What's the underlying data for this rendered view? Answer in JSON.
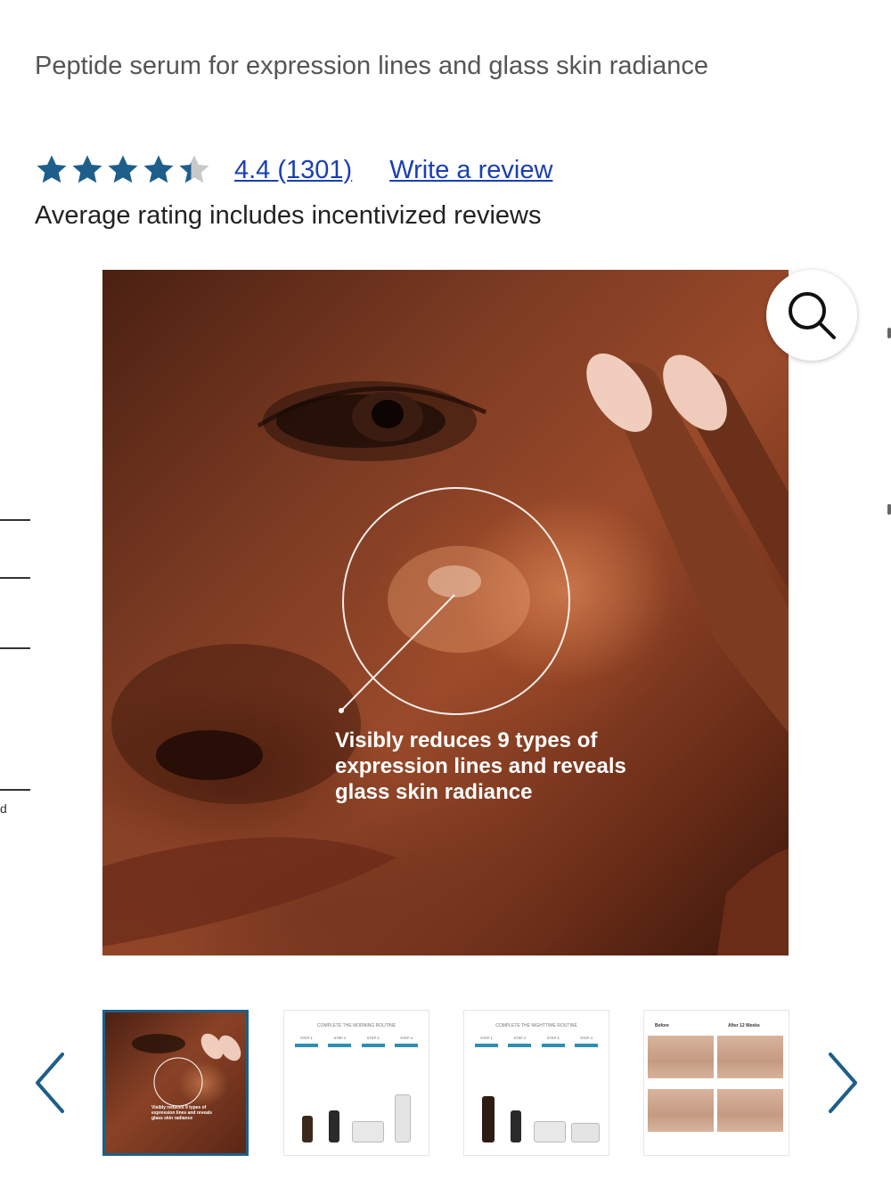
{
  "product": {
    "subtitle": "Peptide serum for expression lines and glass skin radiance"
  },
  "rating": {
    "stars": 4.4,
    "value_text": "4.4",
    "count_text": "(1301)",
    "write_review_label": "Write a review",
    "note": "Average rating includes incentivized reviews",
    "star_color": "#1d5f8a"
  },
  "hero": {
    "caption": "Visibly reduces 9 types of expression lines and reveals glass skin radiance",
    "zoom_icon": "search-icon"
  },
  "side": {
    "letter": "d"
  },
  "thumbnails": {
    "prev_icon": "chevron-left-icon",
    "next_icon": "chevron-right-icon",
    "accent": "#1d5f8a",
    "items": [
      {
        "caption": "Visibly reduces 9 types of expression lines and reveals glass skin radiance"
      },
      {
        "title": "COMPLETE THE MORNING ROUTINE",
        "steps": [
          "STEP 1",
          "STEP 2",
          "STEP 3",
          "STEP 4"
        ]
      },
      {
        "title": "COMPLETE THE NIGHTTIME ROUTINE",
        "steps": [
          "STEP 1",
          "STEP 2",
          "STEP 3",
          "STEP 4"
        ]
      },
      {
        "before": "Before",
        "after": "After 12 Weeks"
      }
    ]
  }
}
